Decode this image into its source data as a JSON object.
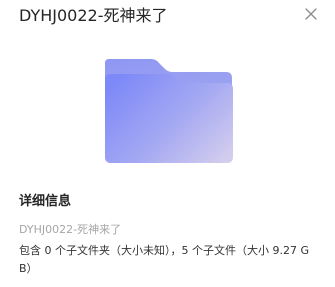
{
  "header": {
    "title": "DYHJ0022-死神来了",
    "close_icon": "close-icon"
  },
  "preview": {
    "icon": "folder-icon",
    "colors": {
      "folder_back": "#8f96f0",
      "folder_front_start": "#7b88f7",
      "folder_front_end": "#cfc9f0"
    }
  },
  "details": {
    "section_title": "详细信息",
    "name": "DYHJ0022-死神来了",
    "description": "包含 0 个子文件夹（大小未知），5 个子文件（大小 9.27 GB）"
  }
}
